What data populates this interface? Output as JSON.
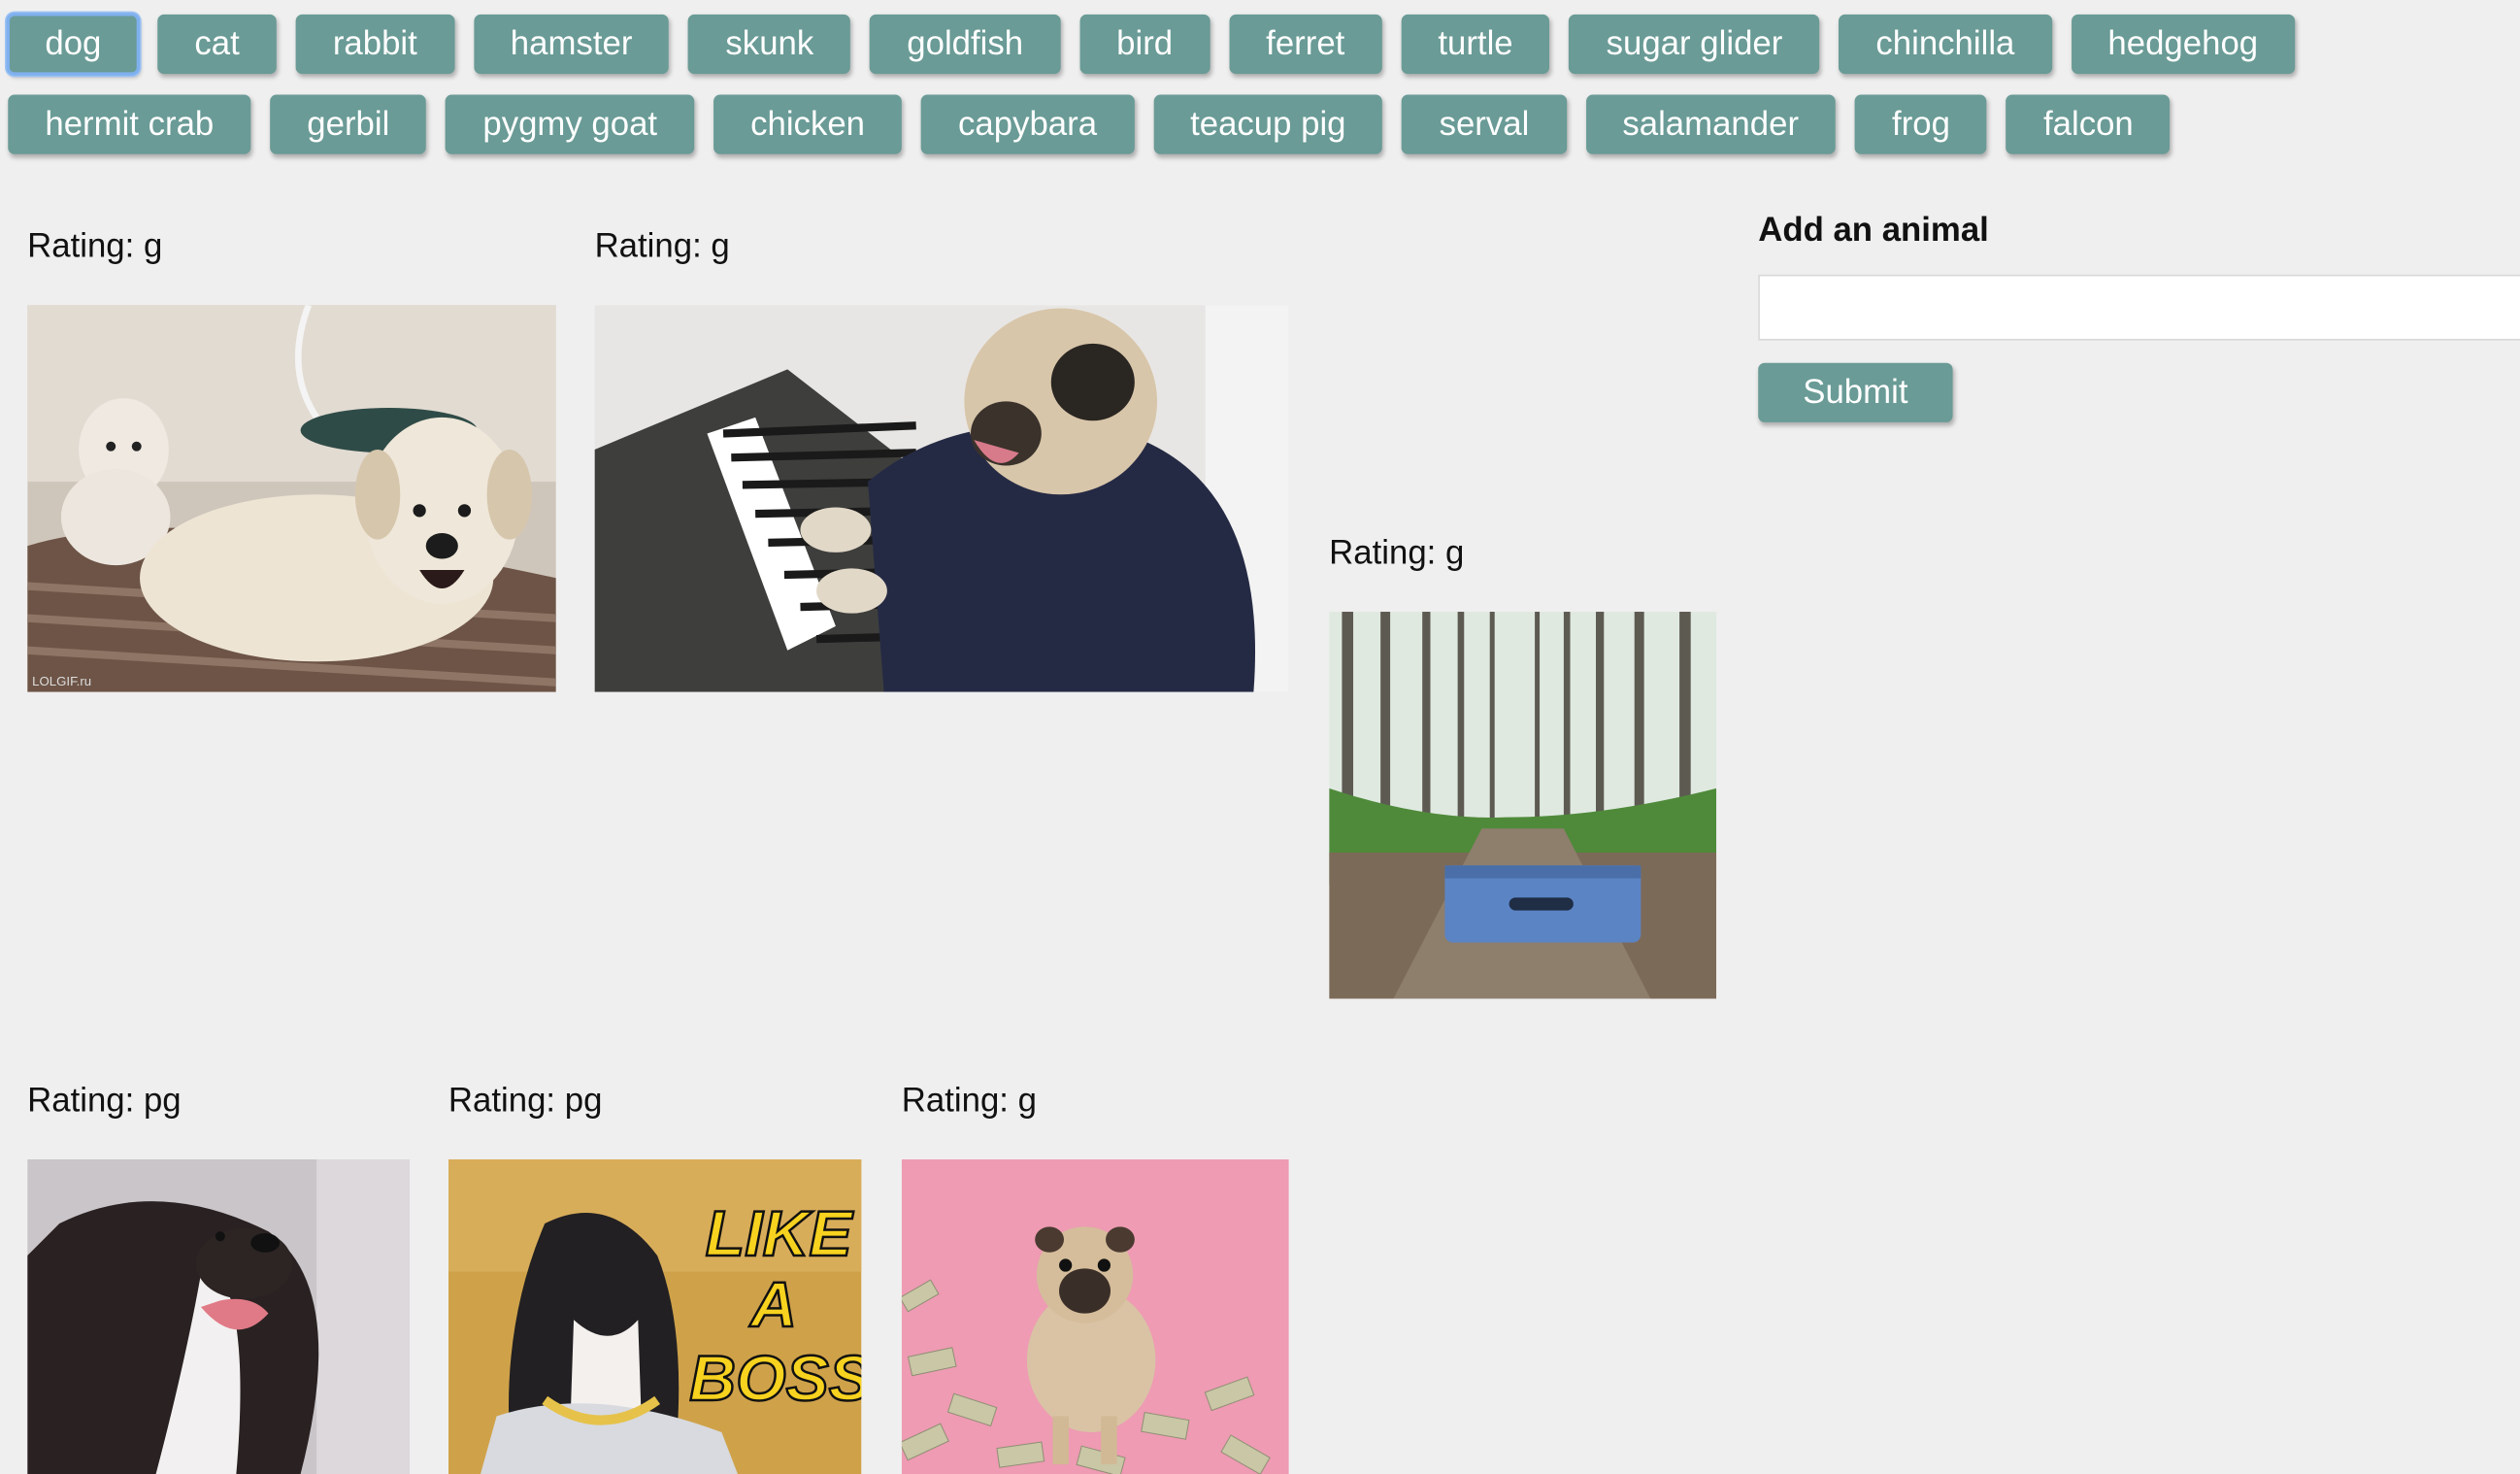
{
  "topics": {
    "row1": [
      "dog",
      "cat",
      "rabbit",
      "hamster",
      "skunk",
      "goldfish",
      "bird",
      "ferret",
      "turtle",
      "sugar glider",
      "chinchilla",
      "hedgehog"
    ],
    "row2": [
      "hermit crab",
      "gerbil",
      "pygmy goat",
      "chicken",
      "capybara",
      "teacup pig",
      "serval",
      "salamander",
      "frog",
      "falcon"
    ],
    "selected": "dog"
  },
  "gifs": [
    {
      "rating_text": "Rating: g",
      "depicts": "two-dogs-on-bed"
    },
    {
      "rating_text": "Rating: g",
      "depicts": "pug-playing-keyboard"
    },
    {
      "rating_text": "Rating: g",
      "depicts": "suitcase-in-forest"
    },
    {
      "rating_text": "Rating: pg",
      "depicts": "black-dog-tongue-out"
    },
    {
      "rating_text": "Rating: pg",
      "depicts": "dog-like-a-boss"
    },
    {
      "rating_text": "Rating: g",
      "depicts": "pug-on-money-pink"
    }
  ],
  "gif_captions": {
    "boss_text_1": "LIKE",
    "boss_text_2": "A",
    "boss_text_3": "BOSS",
    "watermark": "LOLGIF.ru"
  },
  "add_form": {
    "title": "Add an animal",
    "input_value": "",
    "input_placeholder": "",
    "submit_label": "Submit"
  },
  "colors": {
    "button": "#6a9b96",
    "background": "#efefef",
    "focus_ring": "#7fb0ee"
  }
}
